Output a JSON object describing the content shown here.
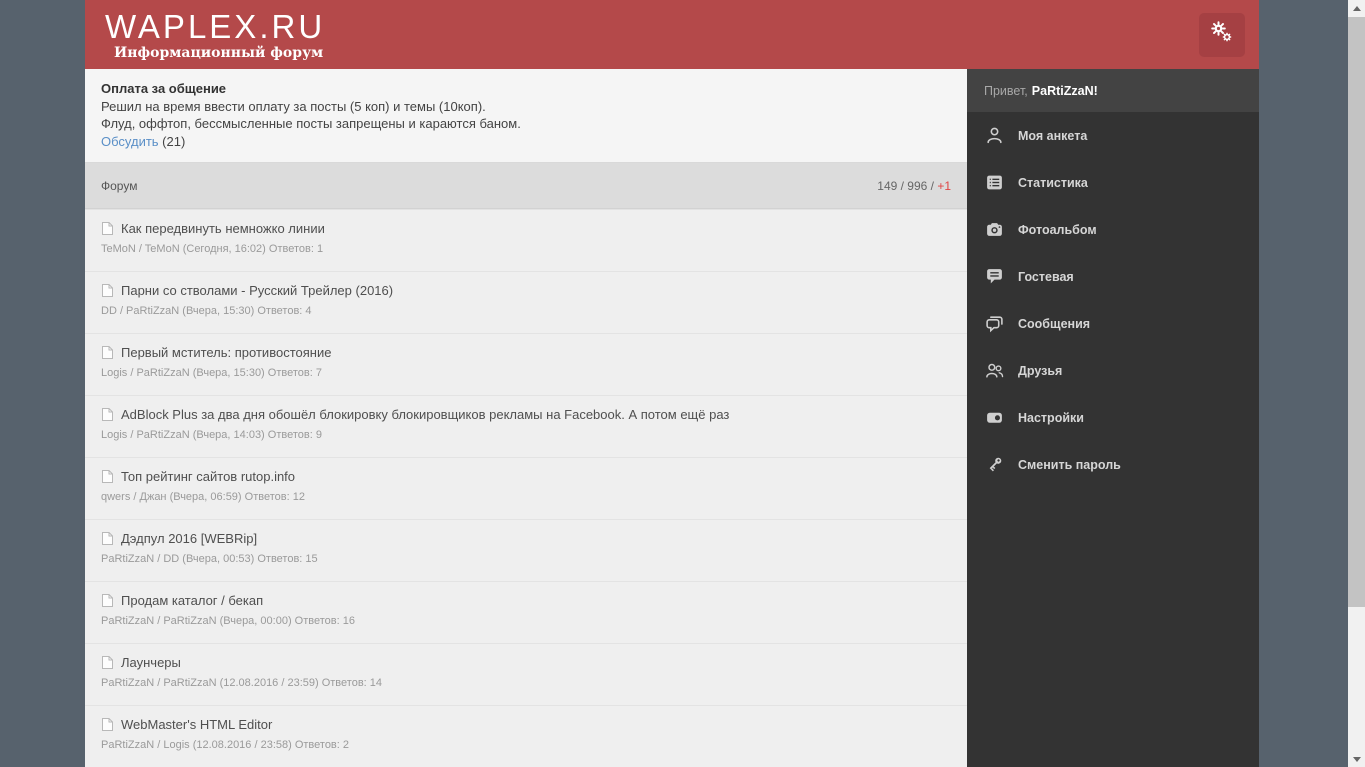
{
  "header": {
    "logo": "WAPLEX.RU",
    "tagline": "Информационный форум",
    "gear_icon": "gears-icon"
  },
  "announcement": {
    "title": "Оплата за общение",
    "line1": "Решил на время ввести оплату за посты (5 коп) и темы (10коп).",
    "line2": "Флуд, оффтоп, бессмысленные посты запрещены и караются баном.",
    "link_label": "Обсудить",
    "link_count": " (21)"
  },
  "forum_bar": {
    "title": "Форум",
    "stats_prefix": "149 / 996 / ",
    "stats_new": "+1"
  },
  "topics": [
    {
      "title": "Как передвинуть немножко линии",
      "meta": "TeMoN / TeMoN (Сегодня, 16:02) Ответов: 1"
    },
    {
      "title": "Парни со стволами - Русский Трейлер (2016)",
      "meta": "DD / PaRtiZzaN (Вчера, 15:30) Ответов: 4"
    },
    {
      "title": "Первый мститель: противостояние",
      "meta": "Logis / PaRtiZzaN (Вчера, 15:30) Ответов: 7"
    },
    {
      "title": "AdBlock Plus за два дня обошёл блокировку блокировщиков рекламы на Facebook. А потом ещё раз",
      "meta": "Logis / PaRtiZzaN (Вчера, 14:03) Ответов: 9"
    },
    {
      "title": "Топ рейтинг сайтов rutop.info",
      "meta": "qwers / Джан (Вчера, 06:59) Ответов: 12"
    },
    {
      "title": "Дэдпул 2016 [WEBRip]",
      "meta": "PaRtiZzaN / DD (Вчера, 00:53) Ответов: 15"
    },
    {
      "title": "Продам каталог / бекап",
      "meta": "PaRtiZzaN / PaRtiZzaN (Вчера, 00:00) Ответов: 16"
    },
    {
      "title": "Лаунчеры",
      "meta": "PaRtiZzaN / PaRtiZzaN (12.08.2016 / 23:59) Ответов: 14"
    },
    {
      "title": "WebMaster's HTML Editor",
      "meta": "PaRtiZzaN / Logis (12.08.2016 / 23:58) Ответов: 2"
    }
  ],
  "sidebar": {
    "greeting_prefix": "Привет,",
    "greeting_name": "PaRtiZzaN!",
    "items": [
      {
        "label": "Моя анкета",
        "icon": "user-icon"
      },
      {
        "label": "Статистика",
        "icon": "stats-icon"
      },
      {
        "label": "Фотоальбом",
        "icon": "camera-icon"
      },
      {
        "label": "Гостевая",
        "icon": "guestbook-icon"
      },
      {
        "label": "Сообщения",
        "icon": "messages-icon"
      },
      {
        "label": "Друзья",
        "icon": "friends-icon"
      },
      {
        "label": "Настройки",
        "icon": "settings-icon"
      },
      {
        "label": "Сменить пароль",
        "icon": "key-icon"
      }
    ]
  },
  "colors": {
    "header_red": "#b4494a",
    "gear_button_red": "#a54043",
    "sidebar_dark": "#333333",
    "greeting_bar": "#434343",
    "page_margin_slate": "#57626d",
    "link_blue": "#5a8fc7",
    "new_count_red": "#e04545",
    "row_bg": "#efefef",
    "forum_bar_bg": "#dcdcdc"
  }
}
